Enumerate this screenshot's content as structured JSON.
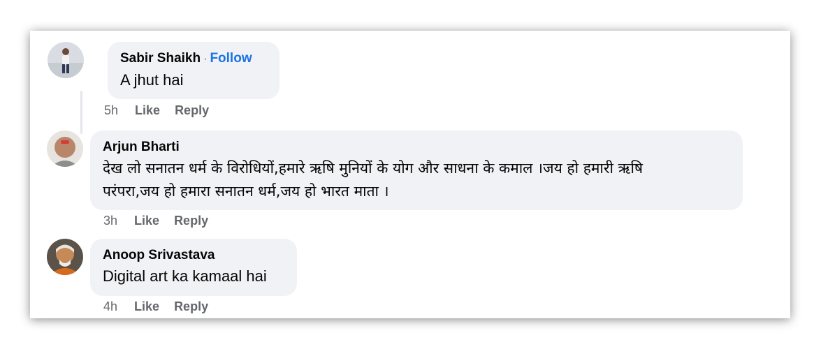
{
  "comments": [
    {
      "author": "Sabir Shaikh",
      "separator": "·",
      "follow_label": "Follow",
      "text": "A jhut hai",
      "time": "5h",
      "like_label": "Like",
      "reply_label": "Reply"
    },
    {
      "author": "Arjun Bharti",
      "text_line1": "देख लो सनातन धर्म के विरोधियों,हमारे ऋषि मुनियों के योग और साधना के कमाल ।जय हो हमारी ऋषि",
      "text_line2": "परंपरा,जय हो हमारा सनातन धर्म,जय हो भारत माता ।",
      "time": "3h",
      "like_label": "Like",
      "reply_label": "Reply"
    },
    {
      "author": "Anoop Srivastava",
      "text": "Digital art ka kamaal hai",
      "time": "4h",
      "like_label": "Like",
      "reply_label": "Reply"
    }
  ],
  "colors": {
    "bubble": "#f0f2f5",
    "follow": "#1b74e4",
    "meta": "#65676b"
  }
}
